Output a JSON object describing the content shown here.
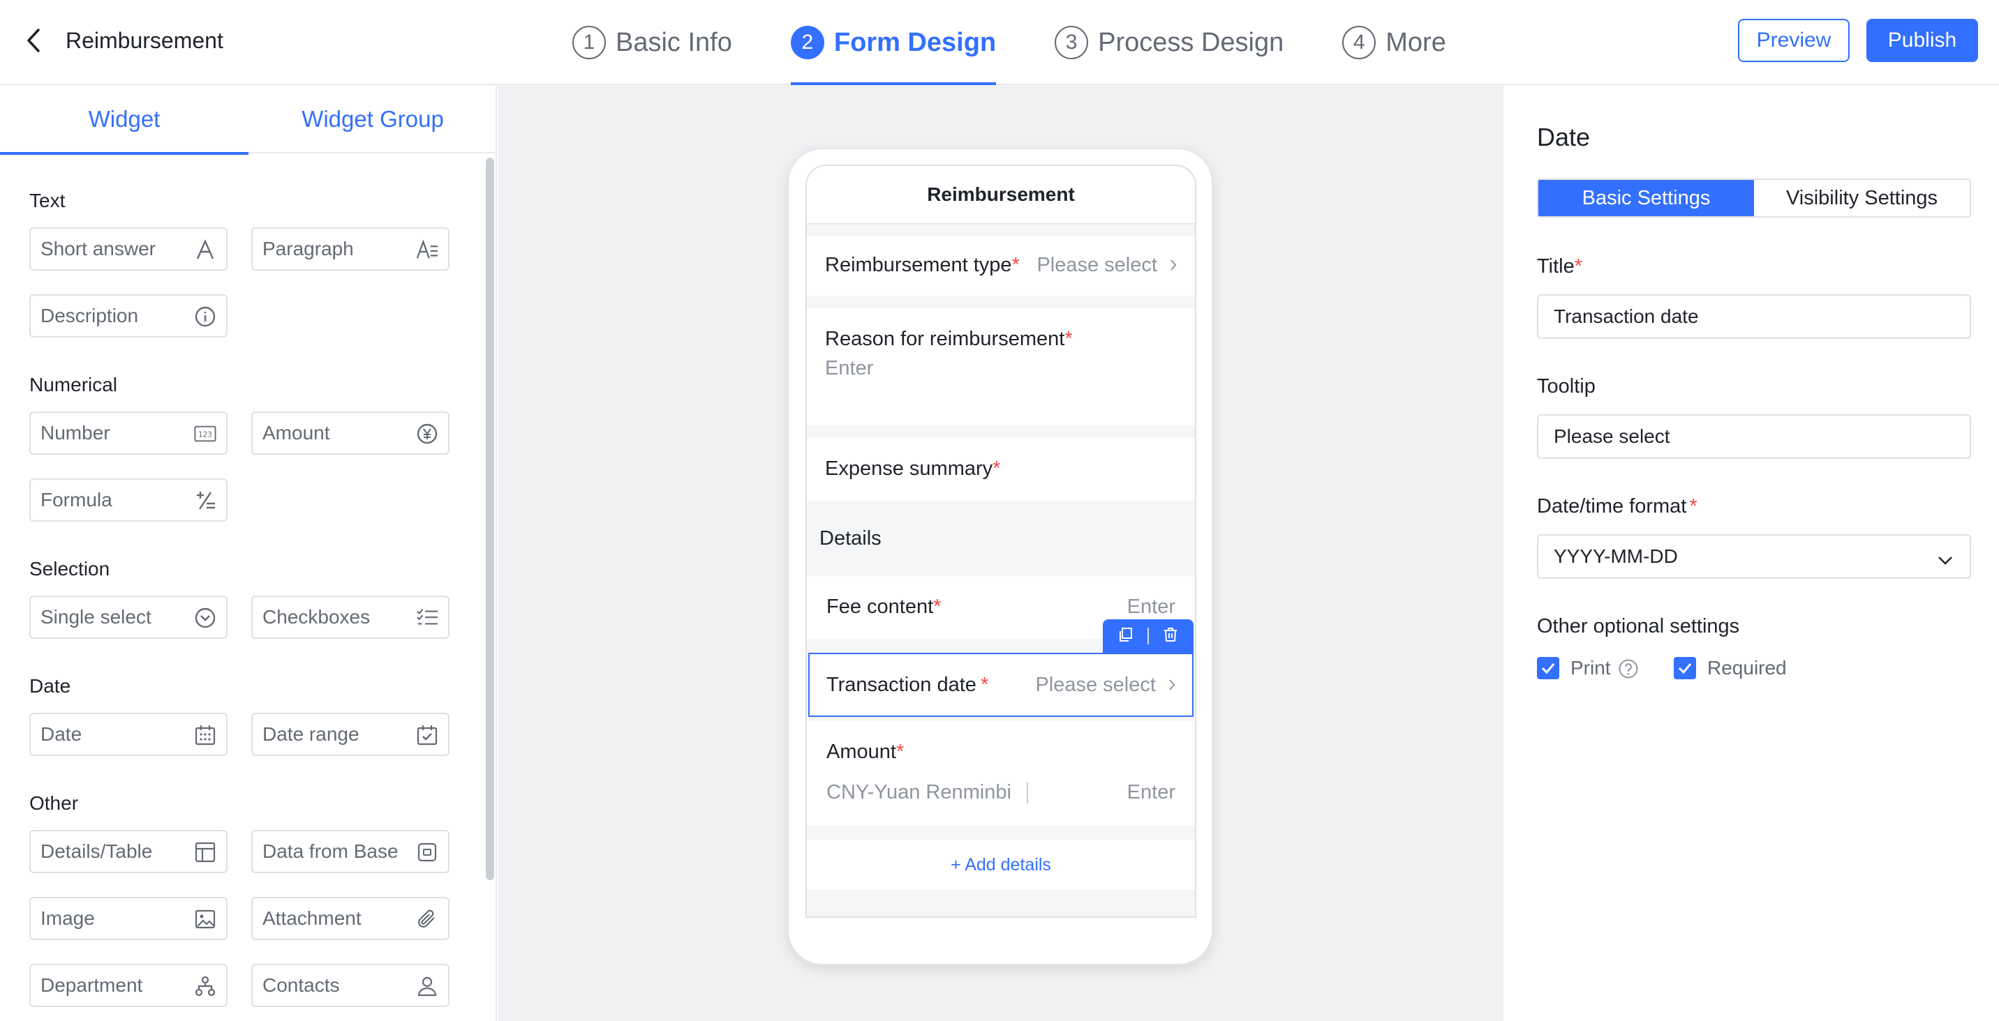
{
  "header": {
    "title": "Reimbursement",
    "steps": [
      {
        "num": "1",
        "label": "Basic Info"
      },
      {
        "num": "2",
        "label": "Form Design"
      },
      {
        "num": "3",
        "label": "Process Design"
      },
      {
        "num": "4",
        "label": "More"
      }
    ],
    "active_step": 1,
    "preview_label": "Preview",
    "publish_label": "Publish"
  },
  "left_panel": {
    "tabs": [
      "Widget",
      "Widget Group"
    ],
    "groups": [
      {
        "title": "Text",
        "items": [
          {
            "label": "Short answer",
            "icon": "text-a-icon"
          },
          {
            "label": "Paragraph",
            "icon": "paragraph-icon"
          },
          {
            "label": "Description",
            "icon": "info-icon"
          }
        ]
      },
      {
        "title": "Numerical",
        "items": [
          {
            "label": "Number",
            "icon": "number-123-icon"
          },
          {
            "label": "Amount",
            "icon": "yen-coin-icon"
          },
          {
            "label": "Formula",
            "icon": "formula-icon"
          }
        ]
      },
      {
        "title": "Selection",
        "items": [
          {
            "label": "Single select",
            "icon": "chevron-circle-icon"
          },
          {
            "label": "Checkboxes",
            "icon": "checklist-icon"
          }
        ]
      },
      {
        "title": "Date",
        "items": [
          {
            "label": "Date",
            "icon": "calendar-icon"
          },
          {
            "label": "Date range",
            "icon": "calendar-check-icon"
          }
        ]
      },
      {
        "title": "Other",
        "items": [
          {
            "label": "Details/Table",
            "icon": "table-icon"
          },
          {
            "label": "Data from Base",
            "icon": "base-data-icon"
          },
          {
            "label": "Image",
            "icon": "image-icon"
          },
          {
            "label": "Attachment",
            "icon": "paperclip-icon"
          },
          {
            "label": "Department",
            "icon": "org-chart-icon"
          },
          {
            "label": "Contacts",
            "icon": "person-icon"
          }
        ]
      }
    ]
  },
  "form_preview": {
    "title": "Reimbursement",
    "reimbursement_type": {
      "label": "Reimbursement type",
      "required": "*",
      "placeholder": "Please select"
    },
    "reason": {
      "label": "Reason for reimbursement",
      "required": "*",
      "placeholder": "Enter"
    },
    "expense_summary": {
      "label": "Expense summary",
      "required": "*"
    },
    "details_label": "Details",
    "fee_content": {
      "label": "Fee content",
      "required": "*",
      "placeholder": "Enter"
    },
    "transaction_date": {
      "label": "Transaction date",
      "required": "*",
      "placeholder": "Please select"
    },
    "amount": {
      "label": "Amount",
      "required": "*",
      "currency": "CNY-Yuan Renminbi",
      "placeholder": "Enter"
    },
    "add_details": "+ Add details"
  },
  "properties": {
    "title": "Date",
    "tabs": [
      "Basic Settings",
      "Visibility Settings"
    ],
    "active_tab": 0,
    "title_field": {
      "label": "Title",
      "required": "*",
      "value": "Transaction date"
    },
    "tooltip_field": {
      "label": "Tooltip",
      "value": "Please select"
    },
    "format_field": {
      "label": "Date/time format",
      "required": "*",
      "value": "YYYY-MM-DD"
    },
    "other_settings": {
      "label": "Other optional settings",
      "options": [
        {
          "label": "Print",
          "checked": true
        },
        {
          "label": "Required",
          "checked": true
        }
      ]
    }
  },
  "colors": {
    "accent": "#3370ff",
    "required": "#f54a45",
    "canvas_bg": "#f0f1f3"
  }
}
